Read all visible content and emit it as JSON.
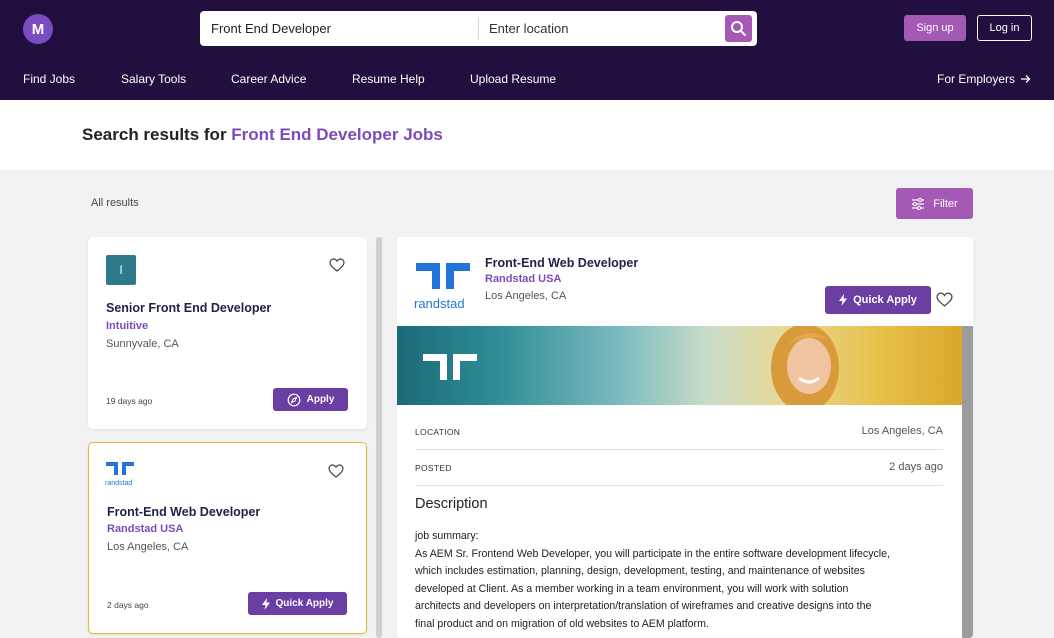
{
  "brand": {
    "logo_letter": "M",
    "accent": "#a45ab4",
    "header_bg": "#21103f",
    "purple": "#6a3ea3"
  },
  "search": {
    "query": "Front End Developer",
    "location_placeholder": "Enter location"
  },
  "auth": {
    "signup": "Sign up",
    "login": "Log in"
  },
  "nav": {
    "items": [
      "Find Jobs",
      "Salary Tools",
      "Career Advice",
      "Resume Help",
      "Upload Resume"
    ],
    "employers": "For Employers"
  },
  "results": {
    "heading_prefix": "Search results for",
    "heading_highlight": "Front End Developer Jobs",
    "all_results": "All results",
    "filter": "Filter"
  },
  "cards": [
    {
      "logo_letter": "I",
      "title": "Senior Front End Developer",
      "company": "Intuitive",
      "location": "Sunnyvale, CA",
      "posted": "19 days ago",
      "button": "Apply"
    },
    {
      "logo_text": "randstad",
      "title": "Front-End Web Developer",
      "company": "Randstad USA",
      "location": "Los Angeles, CA",
      "posted": "2 days ago",
      "button": "Quick Apply"
    }
  ],
  "detail": {
    "logo_text": "randstad",
    "title": "Front-End Web Developer",
    "company": "Randstad USA",
    "location": "Los Angeles, CA",
    "quick_apply": "Quick Apply",
    "location_label": "LOCATION",
    "location_value": "Los Angeles, CA",
    "posted_label": "POSTED",
    "posted_value": "2 days ago",
    "description_heading": "Description",
    "description_lines": [
      "job summary:",
      "As AEM Sr. Frontend Web Developer, you will participate in the entire software development lifecycle,",
      "which includes estimation, planning, design, development, testing, and maintenance of websites",
      "developed at Client. As a member working in a team environment, you will work with solution",
      "architects and developers on interpretation/translation of wireframes and creative designs into the",
      "final product and on migration of old websites to AEM platform."
    ]
  }
}
